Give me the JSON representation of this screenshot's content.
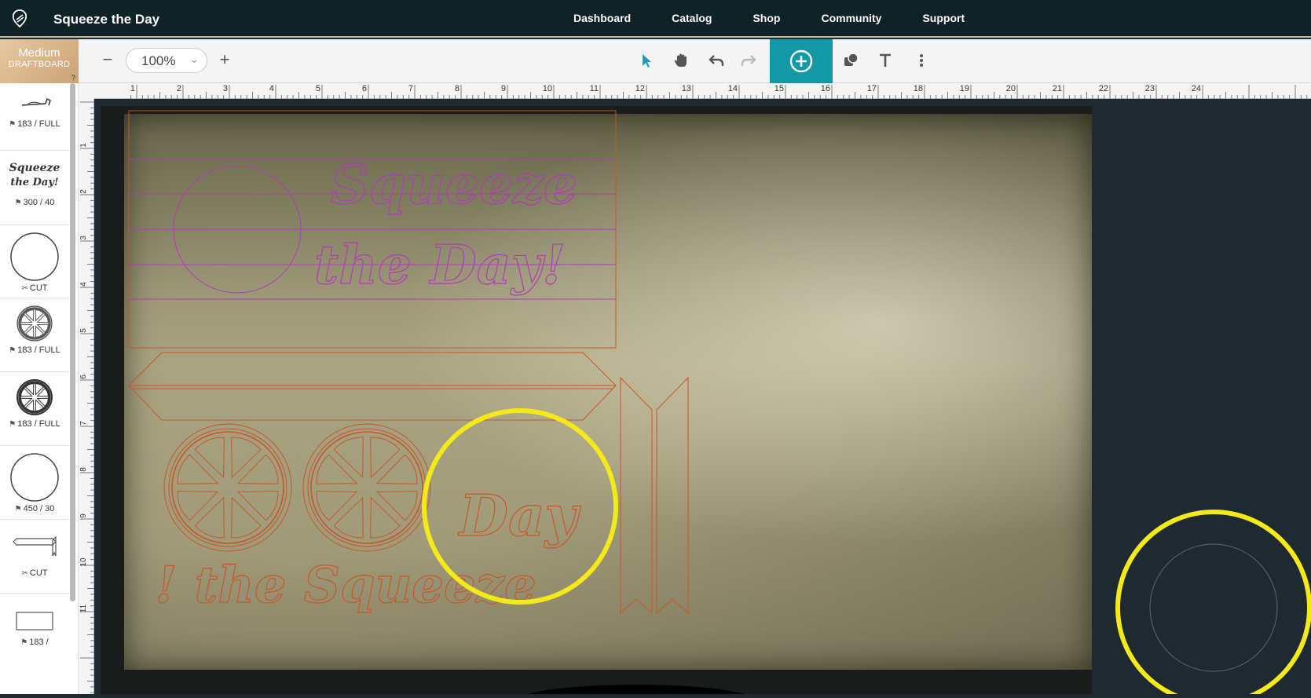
{
  "header": {
    "app_title": "Squeeze the Day",
    "nav": [
      "Dashboard",
      "Catalog",
      "Shop",
      "Community",
      "Support"
    ],
    "logo_icon": "glowforge-logo-icon"
  },
  "toolbar": {
    "material_line1": "Medium",
    "material_line2": "DRAFTBOARD",
    "material_help": "?",
    "zoom_minus": "−",
    "zoom_value": "100%",
    "zoom_plus": "+",
    "tools": [
      "select-arrow-icon",
      "pan-hand-icon",
      "undo-icon",
      "redo-icon",
      "add-icon",
      "shapes-icon",
      "text-icon",
      "more-icon"
    ],
    "accent_color": "#1299a5"
  },
  "ruler": {
    "top_ticks": [
      "1",
      "2",
      "3",
      "4",
      "5",
      "6",
      "7",
      "8",
      "9",
      "10",
      "11",
      "12",
      "13",
      "14",
      "15",
      "16",
      "17",
      "18",
      "19",
      "20",
      "21",
      "22",
      "23",
      "24"
    ],
    "left_ticks": [
      "1",
      "2",
      "3",
      "4",
      "5",
      "6",
      "7",
      "8",
      "9",
      "10",
      "11"
    ]
  },
  "sidebar": {
    "parts": [
      {
        "label": "183 / FULL",
        "icon": "engrave-icon"
      },
      {
        "label": "300 / 40",
        "icon": "engrave-icon"
      },
      {
        "label": "CUT",
        "icon": "cut-icon"
      },
      {
        "label": "183 / FULL",
        "icon": "engrave-icon"
      },
      {
        "label": "183 / FULL",
        "icon": "engrave-icon"
      },
      {
        "label": "450 / 30",
        "icon": "engrave-icon"
      },
      {
        "label": "CUT",
        "icon": "cut-icon"
      },
      {
        "label": "183 /",
        "icon": "engrave-icon"
      }
    ]
  },
  "canvas": {
    "design_text_top_1": "Squeeze",
    "design_text_top_2": "the Day!",
    "design_text_day": "Day",
    "design_text_bottom": "! the Squeeze",
    "highlight_color": "#f4ea19",
    "cut_color": "#c8552a",
    "engrave_color": "#b03ab8"
  }
}
